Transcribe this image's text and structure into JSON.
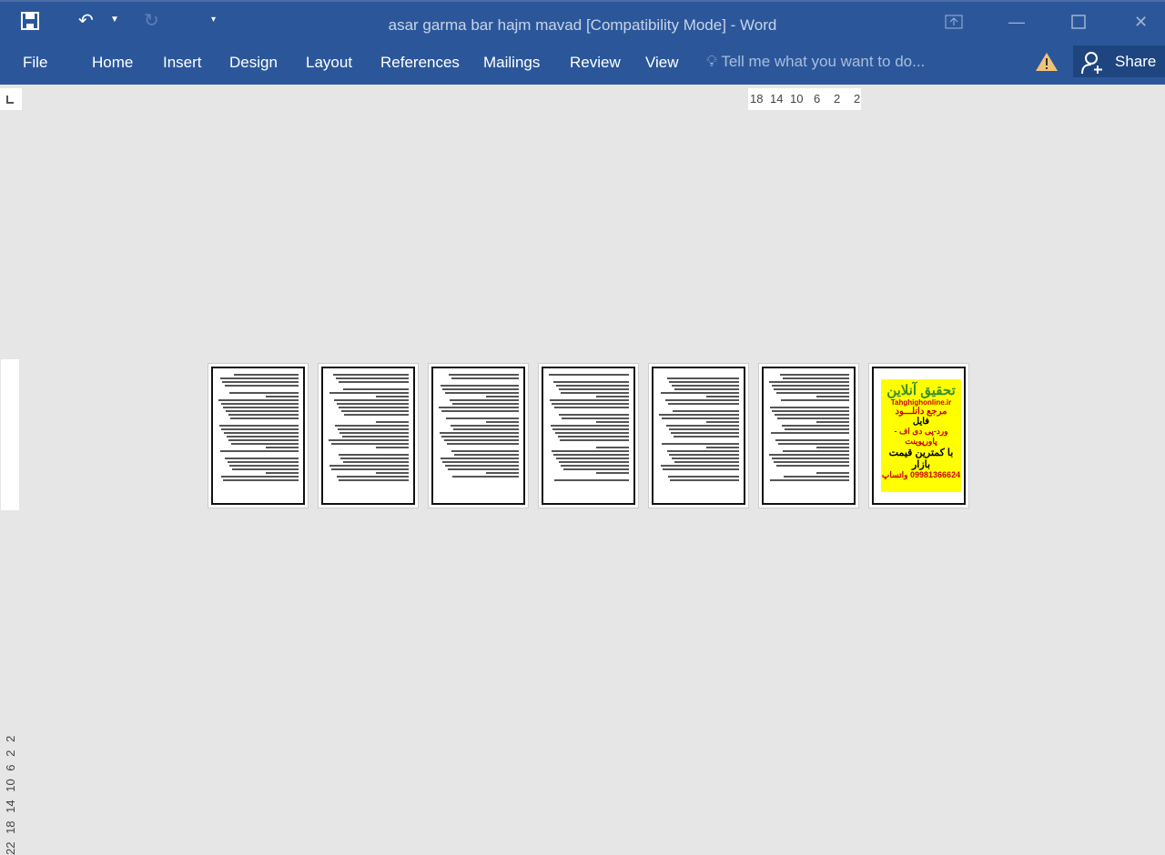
{
  "window": {
    "title": "asar garma bar hajm mavad [Compatibility Mode] - Word"
  },
  "quick_access": {
    "save": "save-icon",
    "undo": "undo-icon",
    "redo": "redo-icon",
    "customize": "customize-icon"
  },
  "ribbon": {
    "tabs": [
      "File",
      "Home",
      "Insert",
      "Design",
      "Layout",
      "References",
      "Mailings",
      "Review",
      "View"
    ],
    "tell_me": "Tell me what you want to do...",
    "share": "Share"
  },
  "ruler": {
    "horizontal": [
      "18",
      "14",
      "10",
      "6",
      "2",
      "2"
    ],
    "vertical": "22 18 14 10 6 2 2"
  },
  "ad_page": {
    "title": "تحقیق آنلاین",
    "site": "Tahghighonline.ir",
    "l1": "مرجع دانلـــود",
    "l2": "فایل",
    "l3": "ورد-پی دی اف - پاورپوینت",
    "l4": "با کمترین قیمت بازار",
    "l5": "09981366624 واتساپ"
  },
  "colors": {
    "ribbon": "#2b579a",
    "ad_bg": "#ffff00"
  }
}
